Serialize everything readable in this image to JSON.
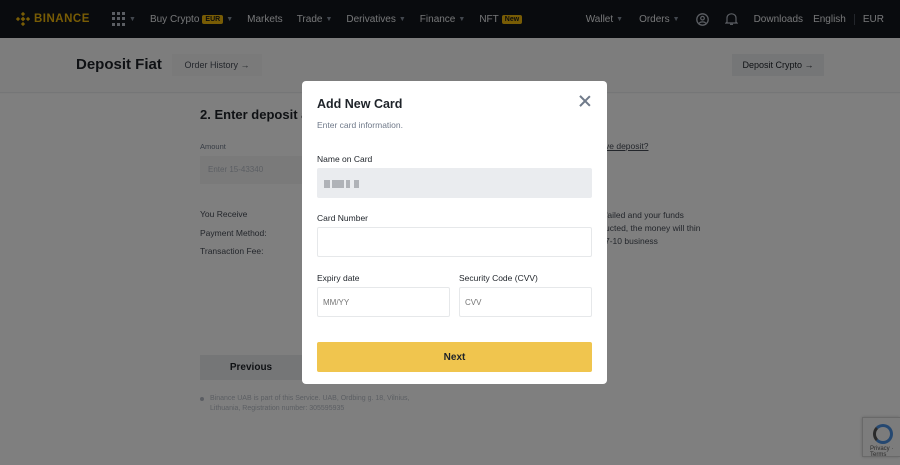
{
  "nav": {
    "logo": "BINANCE",
    "buy_crypto": "Buy Crypto",
    "buy_crypto_tag": "EUR",
    "markets": "Markets",
    "trade": "Trade",
    "derivatives": "Derivatives",
    "finance": "Finance",
    "nft": "NFT",
    "nft_tag": "New",
    "wallet": "Wallet",
    "orders": "Orders",
    "downloads": "Downloads",
    "language": "English",
    "currency": "EUR"
  },
  "header": {
    "title": "Deposit Fiat",
    "order_history": "Order History →",
    "deposit_crypto": "Deposit Crypto →"
  },
  "main": {
    "step_title": "2. Enter deposit amount",
    "amount_label": "Amount",
    "amount_placeholder": "Enter 15-43340",
    "you_receive": "You Receive",
    "payment_method": "Payment Method:",
    "transaction_fee": "Transaction Fee:",
    "previous": "Previous",
    "side_link": "ve deposit?",
    "side_text": "failed and your funds ucted, the money will thin 7-10 business",
    "footnote": "Binance UAB is part of this Service. UAB, Ordbing g. 18, Vilnius, Lithuania, Registration number: 305595935"
  },
  "modal": {
    "title": "Add New Card",
    "subtitle": "Enter card information.",
    "name_label": "Name on Card",
    "card_number_label": "Card Number",
    "card_number_value": "",
    "expiry_label": "Expiry date",
    "expiry_placeholder": "MM/YY",
    "cvv_label": "Security Code (CVV)",
    "cvv_placeholder": "CVV",
    "next": "Next"
  },
  "recaptcha": {
    "text": "Privacy · Terms"
  },
  "colors": {
    "brand": "#f0b90b",
    "nav_bg": "#12161c",
    "next_button": "#f0c54e"
  }
}
